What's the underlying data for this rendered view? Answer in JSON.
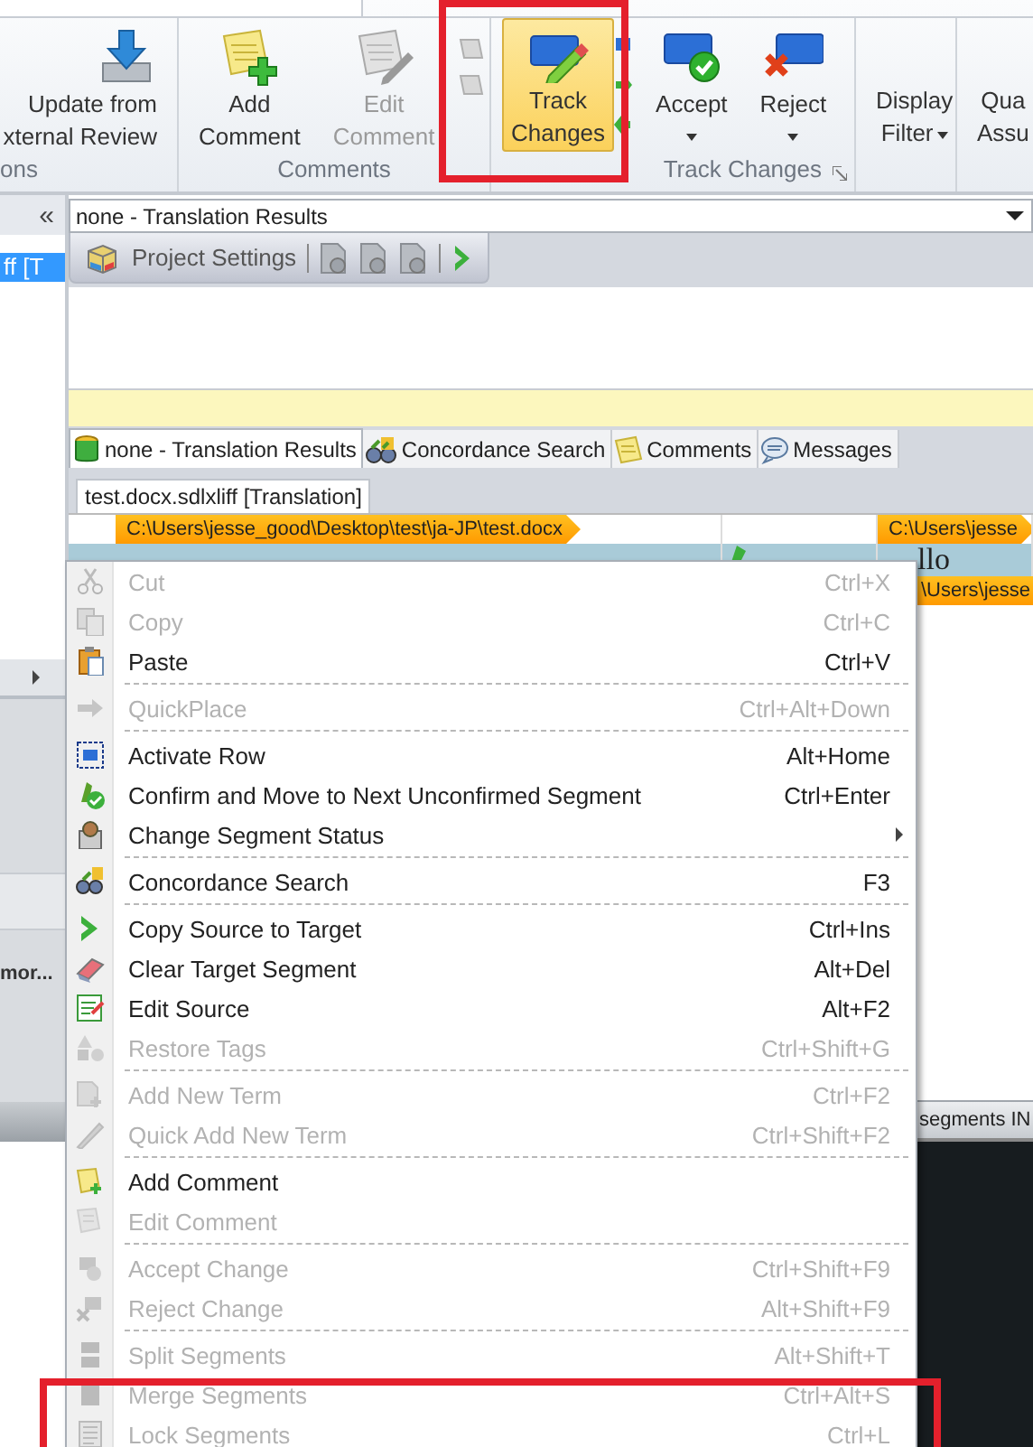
{
  "ribbon": {
    "groups": [
      {
        "label": "ons",
        "launcher": false,
        "buttons": [
          {
            "lines": [
              "Update from",
              "xternal Review"
            ],
            "disabled": false,
            "selected": false,
            "dropdown": false
          }
        ]
      },
      {
        "label": "Comments",
        "launcher": false,
        "buttons": [
          {
            "lines": [
              "Add",
              "Comment"
            ],
            "disabled": false,
            "selected": false,
            "dropdown": false
          },
          {
            "lines": [
              "Edit",
              "Comment"
            ],
            "disabled": true,
            "selected": false,
            "dropdown": false
          }
        ]
      },
      {
        "label": "Track Changes",
        "launcher": true,
        "buttons": [
          {
            "lines": [
              "Track",
              "Changes"
            ],
            "disabled": false,
            "selected": true,
            "dropdown": false
          },
          {
            "lines": [
              "Accept"
            ],
            "disabled": false,
            "selected": false,
            "dropdown": true
          },
          {
            "lines": [
              "Reject"
            ],
            "disabled": false,
            "selected": false,
            "dropdown": true
          }
        ]
      },
      {
        "launcher": false,
        "buttons": [
          {
            "lines": [
              "Display",
              "Filter"
            ],
            "disabled": false,
            "selected": false,
            "dropdown": true
          }
        ]
      },
      {
        "launcher": false,
        "buttons": [
          {
            "lines": [
              "Qua",
              "Assu"
            ],
            "disabled": false,
            "selected": false,
            "dropdown": false
          }
        ]
      }
    ]
  },
  "side_panel": {
    "collapse": "«",
    "items": [
      {
        "label": "ff [T",
        "selected": true
      }
    ],
    "truncated_label": "mor..."
  },
  "editor": {
    "combo": {
      "value": "none - Translation Results"
    },
    "toolbar": {
      "button": "Project Settings"
    },
    "tabs": [
      {
        "label": "none - Translation Results",
        "selected": true
      },
      {
        "label": "Concordance Search",
        "selected": false
      },
      {
        "label": "Comments",
        "selected": false
      },
      {
        "label": "Messages",
        "selected": false
      }
    ],
    "document_tab": {
      "label": "test.docx.sdlxliff [Translation]",
      "selected": true
    },
    "source_path": "C:\\Users\\jesse_good\\Desktop\\test\\ja-JP\\test.docx",
    "target_path": "C:\\Users\\jesse",
    "row": {
      "target": "llo"
    },
    "target_tag": "\\Users\\jesse",
    "status": "segments IN"
  },
  "context_menu": {
    "groups": [
      [
        {
          "label": "Cut",
          "shortcut": "Ctrl+X",
          "disabled": true,
          "submenu": false
        },
        {
          "label": "Copy",
          "shortcut": "Ctrl+C",
          "disabled": true,
          "submenu": false
        },
        {
          "label": "Paste",
          "shortcut": "Ctrl+V",
          "disabled": false,
          "submenu": false
        }
      ],
      [
        {
          "label": "QuickPlace",
          "shortcut": "Ctrl+Alt+Down",
          "disabled": true,
          "submenu": false
        }
      ],
      [
        {
          "label": "Activate Row",
          "shortcut": "Alt+Home",
          "disabled": false,
          "submenu": false
        },
        {
          "label": "Confirm and Move to Next Unconfirmed Segment",
          "shortcut": "Ctrl+Enter",
          "disabled": false,
          "submenu": false
        },
        {
          "label": "Change Segment Status",
          "disabled": false,
          "submenu": true
        }
      ],
      [
        {
          "label": "Concordance Search",
          "shortcut": "F3",
          "disabled": false,
          "submenu": false
        }
      ],
      [
        {
          "label": "Copy Source to Target",
          "shortcut": "Ctrl+Ins",
          "disabled": false,
          "submenu": false
        },
        {
          "label": "Clear Target Segment",
          "shortcut": "Alt+Del",
          "disabled": false,
          "submenu": false
        },
        {
          "label": "Edit Source",
          "shortcut": "Alt+F2",
          "disabled": false,
          "submenu": false
        },
        {
          "label": "Restore Tags",
          "shortcut": "Ctrl+Shift+G",
          "disabled": true,
          "submenu": false
        }
      ],
      [
        {
          "label": "Add New Term",
          "shortcut": "Ctrl+F2",
          "disabled": true,
          "submenu": false
        },
        {
          "label": "Quick Add New Term",
          "shortcut": "Ctrl+Shift+F2",
          "disabled": true,
          "submenu": false
        }
      ],
      [
        {
          "label": "Add Comment",
          "disabled": false,
          "submenu": false
        },
        {
          "label": "Edit Comment",
          "disabled": true,
          "submenu": false
        }
      ],
      [
        {
          "label": "Accept Change",
          "shortcut": "Ctrl+Shift+F9",
          "disabled": true,
          "submenu": false
        },
        {
          "label": "Reject Change",
          "shortcut": "Alt+Shift+F9",
          "disabled": true,
          "submenu": false
        }
      ],
      [
        {
          "label": "Split Segments",
          "shortcut": "Alt+Shift+T",
          "disabled": true,
          "submenu": false
        },
        {
          "label": "Merge Segments",
          "shortcut": "Ctrl+Alt+S",
          "disabled": true,
          "submenu": false
        },
        {
          "label": "Lock Segments",
          "shortcut": "Ctrl+L",
          "disabled": true,
          "submenu": false
        }
      ]
    ]
  }
}
